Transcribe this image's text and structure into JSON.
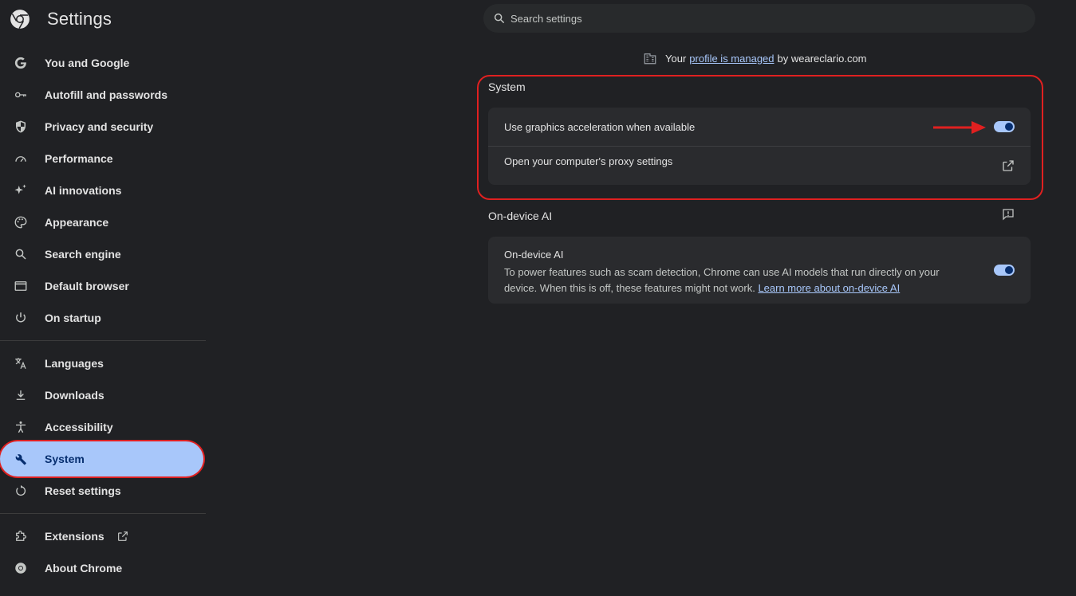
{
  "app": {
    "title": "Settings"
  },
  "search": {
    "placeholder": "Search settings"
  },
  "sidebar": {
    "items": [
      {
        "label": "You and Google"
      },
      {
        "label": "Autofill and passwords"
      },
      {
        "label": "Privacy and security"
      },
      {
        "label": "Performance"
      },
      {
        "label": "AI innovations"
      },
      {
        "label": "Appearance"
      },
      {
        "label": "Search engine"
      },
      {
        "label": "Default browser"
      },
      {
        "label": "On startup"
      },
      {
        "label": "Languages"
      },
      {
        "label": "Downloads"
      },
      {
        "label": "Accessibility"
      },
      {
        "label": "System"
      },
      {
        "label": "Reset settings"
      },
      {
        "label": "Extensions"
      },
      {
        "label": "About Chrome"
      }
    ],
    "active": "System"
  },
  "managed": {
    "prefix": "Your",
    "link": "profile is managed",
    "suffix": "by weareclario.com"
  },
  "system": {
    "title": "System",
    "graphics_label": "Use graphics acceleration when available",
    "graphics_on": true,
    "proxy_label": "Open your computer's proxy settings"
  },
  "ondevice": {
    "title": "On-device AI",
    "row_title": "On-device AI",
    "desc": "To power features such as scam detection, Chrome can use AI models that run directly on your device. When this is off, these features might not work.",
    "link": "Learn more about on-device AI",
    "enabled": true
  },
  "colors": {
    "accent": "#a8c7fa",
    "highlight": "#e02020",
    "background": "#202124"
  }
}
